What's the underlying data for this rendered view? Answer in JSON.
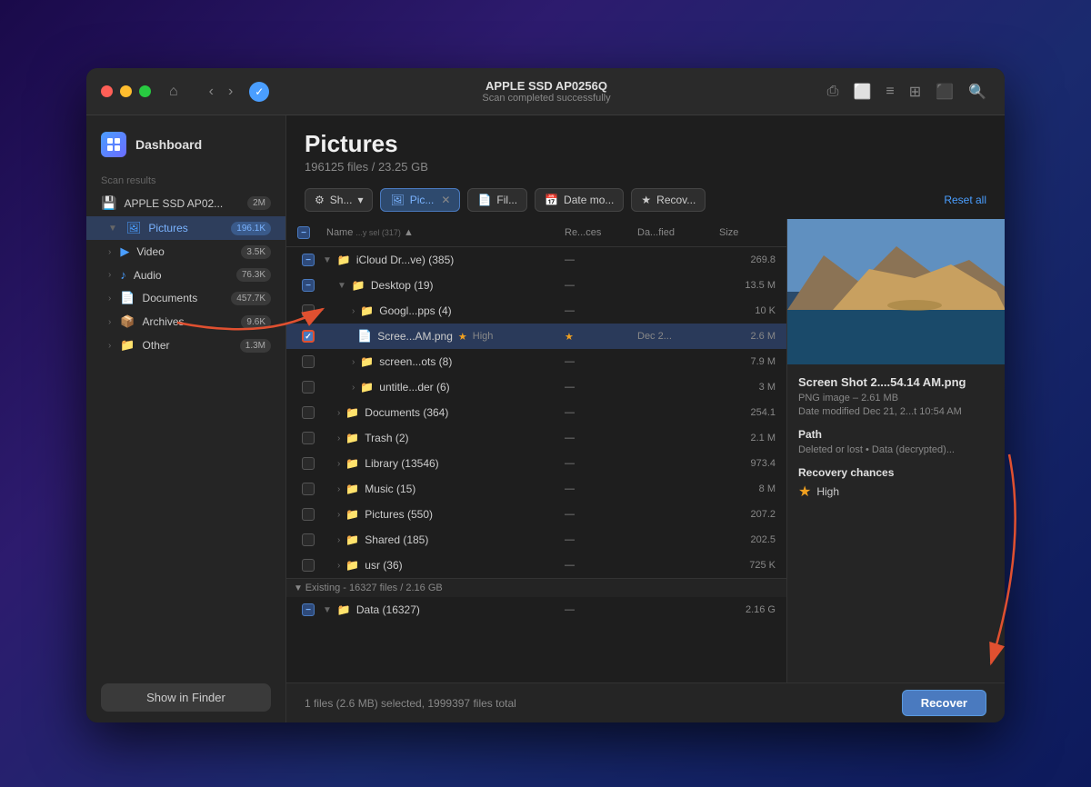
{
  "window": {
    "titlebar": {
      "title": "APPLE SSD AP0256Q",
      "subtitle": "Scan completed successfully"
    },
    "traffic_lights": {
      "close": "close",
      "minimize": "minimize",
      "maximize": "maximize"
    }
  },
  "sidebar": {
    "dashboard_label": "Dashboard",
    "section_label": "Scan results",
    "device": {
      "label": "APPLE SSD AP02...",
      "badge": "2M"
    },
    "items": [
      {
        "id": "pictures",
        "label": "Pictures",
        "count": "196.1K",
        "active": true
      },
      {
        "id": "video",
        "label": "Video",
        "count": "3.5K",
        "active": false
      },
      {
        "id": "audio",
        "label": "Audio",
        "count": "76.3K",
        "active": false
      },
      {
        "id": "documents",
        "label": "Documents",
        "count": "457.7K",
        "active": false
      },
      {
        "id": "archives",
        "label": "Archives",
        "count": "9.6K",
        "active": false
      },
      {
        "id": "other",
        "label": "Other",
        "count": "1.3M",
        "active": false
      }
    ],
    "show_finder_label": "Show in Finder"
  },
  "content": {
    "page_title": "Pictures",
    "page_subtitle": "196125 files / 23.25 GB",
    "filters": [
      {
        "id": "show",
        "label": "Sh...",
        "has_dropdown": true
      },
      {
        "id": "pictures",
        "label": "Pic...",
        "has_close": true,
        "active": true
      },
      {
        "id": "files",
        "label": "Fil..."
      },
      {
        "id": "date",
        "label": "Date mo..."
      },
      {
        "id": "recovery",
        "label": "Recov..."
      }
    ],
    "reset_all": "Reset all",
    "table": {
      "headers": [
        {
          "id": "checkbox",
          "label": ""
        },
        {
          "id": "name",
          "label": "Name"
        },
        {
          "id": "recovery",
          "label": "Re...ces"
        },
        {
          "id": "date",
          "label": "Da...fied"
        },
        {
          "id": "size",
          "label": "Size"
        }
      ],
      "rows": [
        {
          "type": "group",
          "checked": "minus",
          "name": "iCloud Dr...ve) (385)",
          "indent": 0,
          "recovery": "—",
          "date": "",
          "size": "269.8"
        },
        {
          "type": "group",
          "checked": "minus",
          "name": "Desktop (19)",
          "indent": 1,
          "recovery": "—",
          "date": "",
          "size": "13.5 M"
        },
        {
          "type": "folder",
          "checked": false,
          "name": "Googl...pps (4)",
          "indent": 2,
          "recovery": "—",
          "date": "",
          "size": "10 K"
        },
        {
          "type": "file",
          "checked": true,
          "name": "Scree...AM.png",
          "indent": 2,
          "recovery": "High",
          "date": "Dec 2...",
          "size": "2.6 M",
          "selected": true
        },
        {
          "type": "folder",
          "checked": false,
          "name": "screen...ots (8)",
          "indent": 2,
          "recovery": "—",
          "date": "",
          "size": "7.9 M"
        },
        {
          "type": "folder",
          "checked": false,
          "name": "untitle...der (6)",
          "indent": 2,
          "recovery": "—",
          "date": "",
          "size": "3 M"
        },
        {
          "type": "folder",
          "checked": false,
          "name": "Documents (364)",
          "indent": 1,
          "recovery": "—",
          "date": "",
          "size": "254.1"
        },
        {
          "type": "folder",
          "checked": false,
          "name": "Trash (2)",
          "indent": 1,
          "recovery": "—",
          "date": "",
          "size": "2.1 M"
        },
        {
          "type": "folder",
          "checked": false,
          "name": "Library (13546)",
          "indent": 1,
          "recovery": "—",
          "date": "",
          "size": "973.4"
        },
        {
          "type": "folder",
          "checked": false,
          "name": "Music (15)",
          "indent": 1,
          "recovery": "—",
          "date": "",
          "size": "8 M"
        },
        {
          "type": "folder",
          "checked": false,
          "name": "Pictures (550)",
          "indent": 1,
          "recovery": "—",
          "date": "",
          "size": "207.2"
        },
        {
          "type": "folder",
          "checked": false,
          "name": "Shared (185)",
          "indent": 1,
          "recovery": "—",
          "date": "",
          "size": "202.5"
        },
        {
          "type": "folder",
          "checked": false,
          "name": "usr (36)",
          "indent": 1,
          "recovery": "—",
          "date": "",
          "size": "725 K"
        }
      ],
      "existing_group": "Existing - 16327 files / 2.16 GB",
      "existing_rows": [
        {
          "type": "group",
          "checked": "minus",
          "name": "Data (16327)",
          "indent": 0,
          "recovery": "—",
          "date": "",
          "size": "2.16 G"
        }
      ]
    }
  },
  "detail": {
    "filename": "Screen Shot 2....54.14 AM.png",
    "file_type": "PNG image – 2.61 MB",
    "date_modified": "Date modified Dec 21, 2...t 10:54 AM",
    "path_label": "Path",
    "path_value": "Deleted or lost • Data (decrypted)...",
    "recovery_label": "Recovery chances",
    "recovery_value": "High"
  },
  "bottom": {
    "status": "1 files (2.6 MB) selected, 1999397 files total",
    "recover_label": "Recover"
  },
  "colors": {
    "accent": "#4a9eff",
    "recover_btn": "#4a7abf",
    "selected_row": "#2a3a5a",
    "sidebar_active": "#2e3e5c",
    "star": "#f0a020"
  }
}
